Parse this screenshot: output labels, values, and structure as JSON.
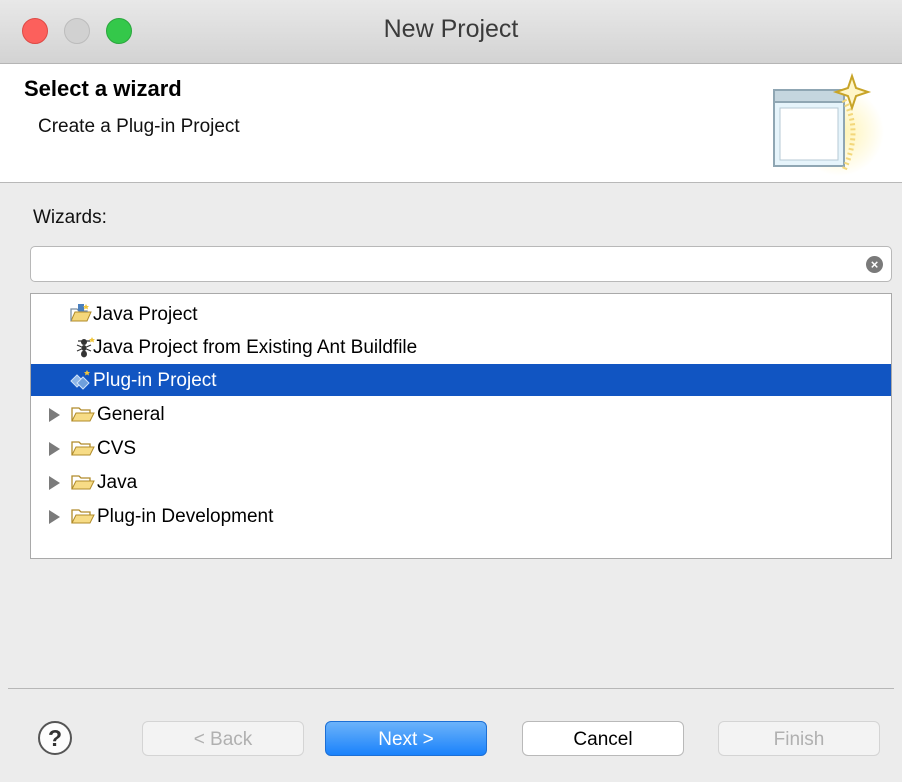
{
  "window": {
    "title": "New Project"
  },
  "header": {
    "title": "Select a wizard",
    "description": "Create a Plug-in Project"
  },
  "wizards": {
    "label": "Wizards:",
    "search_value": "",
    "tree": [
      {
        "label": "Java Project",
        "icon": "java-project-icon",
        "selected": false,
        "expandable": false
      },
      {
        "label": "Java Project from Existing Ant Buildfile",
        "icon": "ant-icon",
        "selected": false,
        "expandable": false
      },
      {
        "label": "Plug-in Project",
        "icon": "plugin-project-icon",
        "selected": true,
        "expandable": false
      },
      {
        "label": "General",
        "icon": "folder-icon",
        "selected": false,
        "expandable": true
      },
      {
        "label": "CVS",
        "icon": "folder-icon",
        "selected": false,
        "expandable": true
      },
      {
        "label": "Java",
        "icon": "folder-icon",
        "selected": false,
        "expandable": true
      },
      {
        "label": "Plug-in Development",
        "icon": "folder-icon",
        "selected": false,
        "expandable": true
      }
    ]
  },
  "buttons": {
    "help": "?",
    "back": "< Back",
    "next": "Next >",
    "cancel": "Cancel",
    "finish": "Finish"
  },
  "colors": {
    "selection": "#1155c2",
    "default_button": "#1a82fb",
    "close": "#fc605c",
    "maximize": "#34c84a"
  }
}
